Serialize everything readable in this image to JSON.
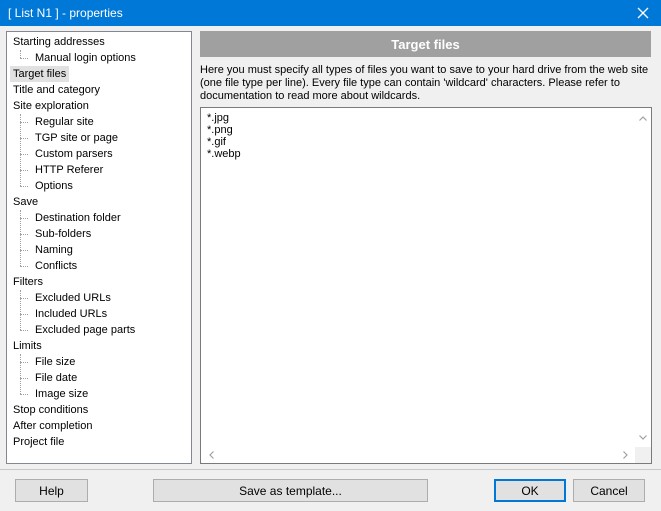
{
  "window": {
    "title": "[ List N1 ] - properties",
    "close_icon": "close-icon",
    "accent_color": "#0078d7"
  },
  "tree": {
    "selected": "Target files",
    "items": [
      {
        "label": "Starting addresses",
        "level": 0
      },
      {
        "label": "Manual login options",
        "level": 1
      },
      {
        "label": "Target files",
        "level": 0
      },
      {
        "label": "Title and category",
        "level": 0
      },
      {
        "label": "Site exploration",
        "level": 0
      },
      {
        "label": "Regular site",
        "level": 1
      },
      {
        "label": "TGP site or page",
        "level": 1
      },
      {
        "label": "Custom parsers",
        "level": 1
      },
      {
        "label": "HTTP Referer",
        "level": 1
      },
      {
        "label": "Options",
        "level": 1
      },
      {
        "label": "Save",
        "level": 0
      },
      {
        "label": "Destination folder",
        "level": 1
      },
      {
        "label": "Sub-folders",
        "level": 1
      },
      {
        "label": "Naming",
        "level": 1
      },
      {
        "label": "Conflicts",
        "level": 1
      },
      {
        "label": "Filters",
        "level": 0
      },
      {
        "label": "Excluded URLs",
        "level": 1
      },
      {
        "label": "Included URLs",
        "level": 1
      },
      {
        "label": "Excluded page parts",
        "level": 1
      },
      {
        "label": "Limits",
        "level": 0
      },
      {
        "label": "File size",
        "level": 1
      },
      {
        "label": "File date",
        "level": 1
      },
      {
        "label": "Image size",
        "level": 1
      },
      {
        "label": "Stop conditions",
        "level": 0
      },
      {
        "label": "After completion",
        "level": 0
      },
      {
        "label": "Project file",
        "level": 0
      }
    ]
  },
  "panel": {
    "header": "Target files",
    "description": [
      "Here you must specify all types of files you want to save to your hard drive from the web site",
      "(one file type per line). Every file type can contain 'wildcard' characters. Please refer to",
      "documentation to read more about wildcards."
    ],
    "file_types": [
      "*.jpg",
      "*.png",
      "*.gif",
      "*.webp"
    ]
  },
  "buttons": {
    "help": "Help",
    "save_template": "Save as template...",
    "ok": "OK",
    "cancel": "Cancel"
  }
}
